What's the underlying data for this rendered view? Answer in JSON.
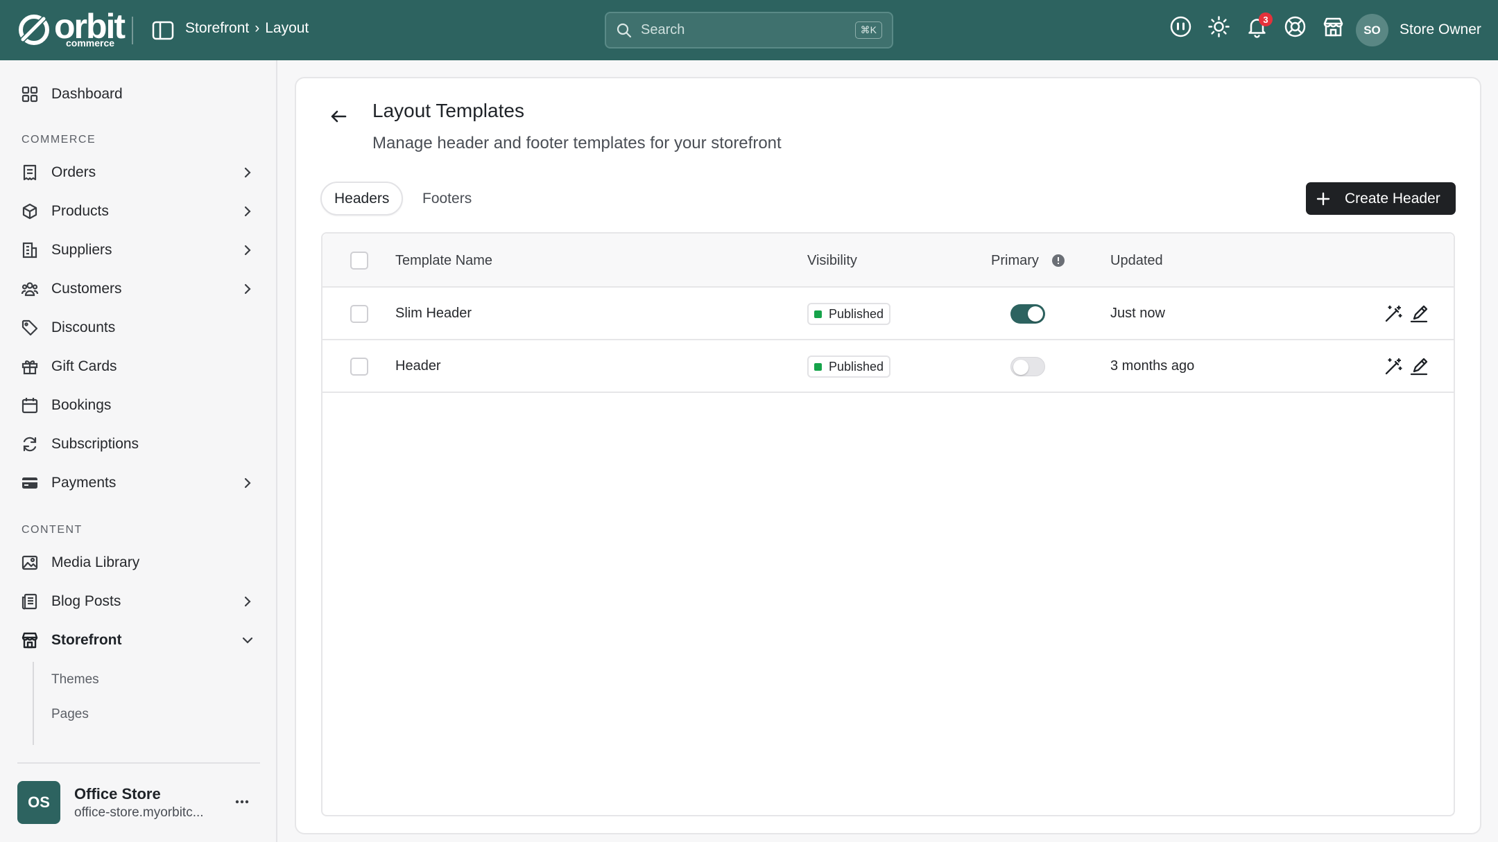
{
  "app": {
    "logo_text": "orbit",
    "logo_sub": "commerce"
  },
  "header": {
    "breadcrumb_section": "Storefront",
    "breadcrumb_sep": "›",
    "breadcrumb_page": "Layout",
    "search_placeholder": "Search",
    "search_shortcut": "⌘K",
    "notification_count": "3",
    "user_initials": "SO",
    "user_name": "Store Owner"
  },
  "sidebar": {
    "dashboard": "Dashboard",
    "section_commerce": "COMMERCE",
    "orders": "Orders",
    "products": "Products",
    "suppliers": "Suppliers",
    "customers": "Customers",
    "discounts": "Discounts",
    "gift_cards": "Gift Cards",
    "bookings": "Bookings",
    "subscriptions": "Subscriptions",
    "payments": "Payments",
    "section_content": "CONTENT",
    "media_library": "Media Library",
    "blog_posts": "Blog Posts",
    "storefront": "Storefront",
    "sub_items": [
      "Themes",
      "Pages"
    ],
    "store": {
      "initials": "OS",
      "name": "Office Store",
      "url": "office-store.myorbitc..."
    }
  },
  "main": {
    "title": "Layout Templates",
    "subtitle": "Manage header and footer templates for your storefront",
    "tabs": [
      "Headers",
      "Footers"
    ],
    "create_button": "Create Header",
    "columns": {
      "name": "Template Name",
      "visibility": "Visibility",
      "primary": "Primary",
      "updated": "Updated"
    },
    "rows": [
      {
        "name": "Slim Header",
        "visibility": "Published",
        "primary": true,
        "updated": "Just now"
      },
      {
        "name": "Header",
        "visibility": "Published",
        "primary": false,
        "updated": "3 months ago"
      }
    ]
  },
  "colors": {
    "brand": "#2d6360",
    "published": "#16a34a",
    "badge": "#e5313b"
  }
}
